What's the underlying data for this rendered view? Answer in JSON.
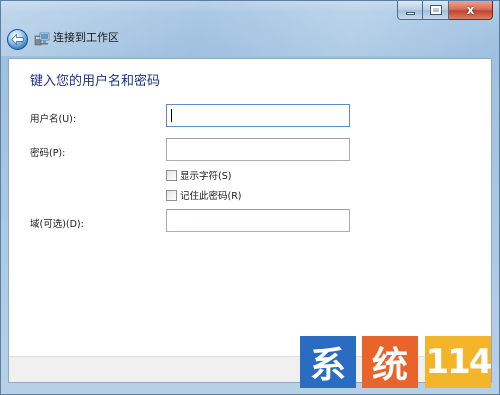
{
  "window": {
    "title": "连接到工作区",
    "caption_close_glyph": "x"
  },
  "form": {
    "heading": "键入您的用户名和密码",
    "username_label": "用户名(U):",
    "username_value": "",
    "password_label": "密码(P):",
    "password_value": "",
    "show_chars_label": "显示字符(S)",
    "show_chars_checked": false,
    "remember_label": "记住此密码(R)",
    "remember_checked": false,
    "domain_label": "域(可选)(D):",
    "domain_value": ""
  },
  "watermark": {
    "char1": "系",
    "char2": "统",
    "number": "114"
  },
  "colors": {
    "heading": "#1e3287",
    "frame": "#a9c8e4",
    "watermark_blue": "#2a6cc1",
    "watermark_orange": "#e8642a",
    "watermark_yellow": "#f3b42a"
  }
}
